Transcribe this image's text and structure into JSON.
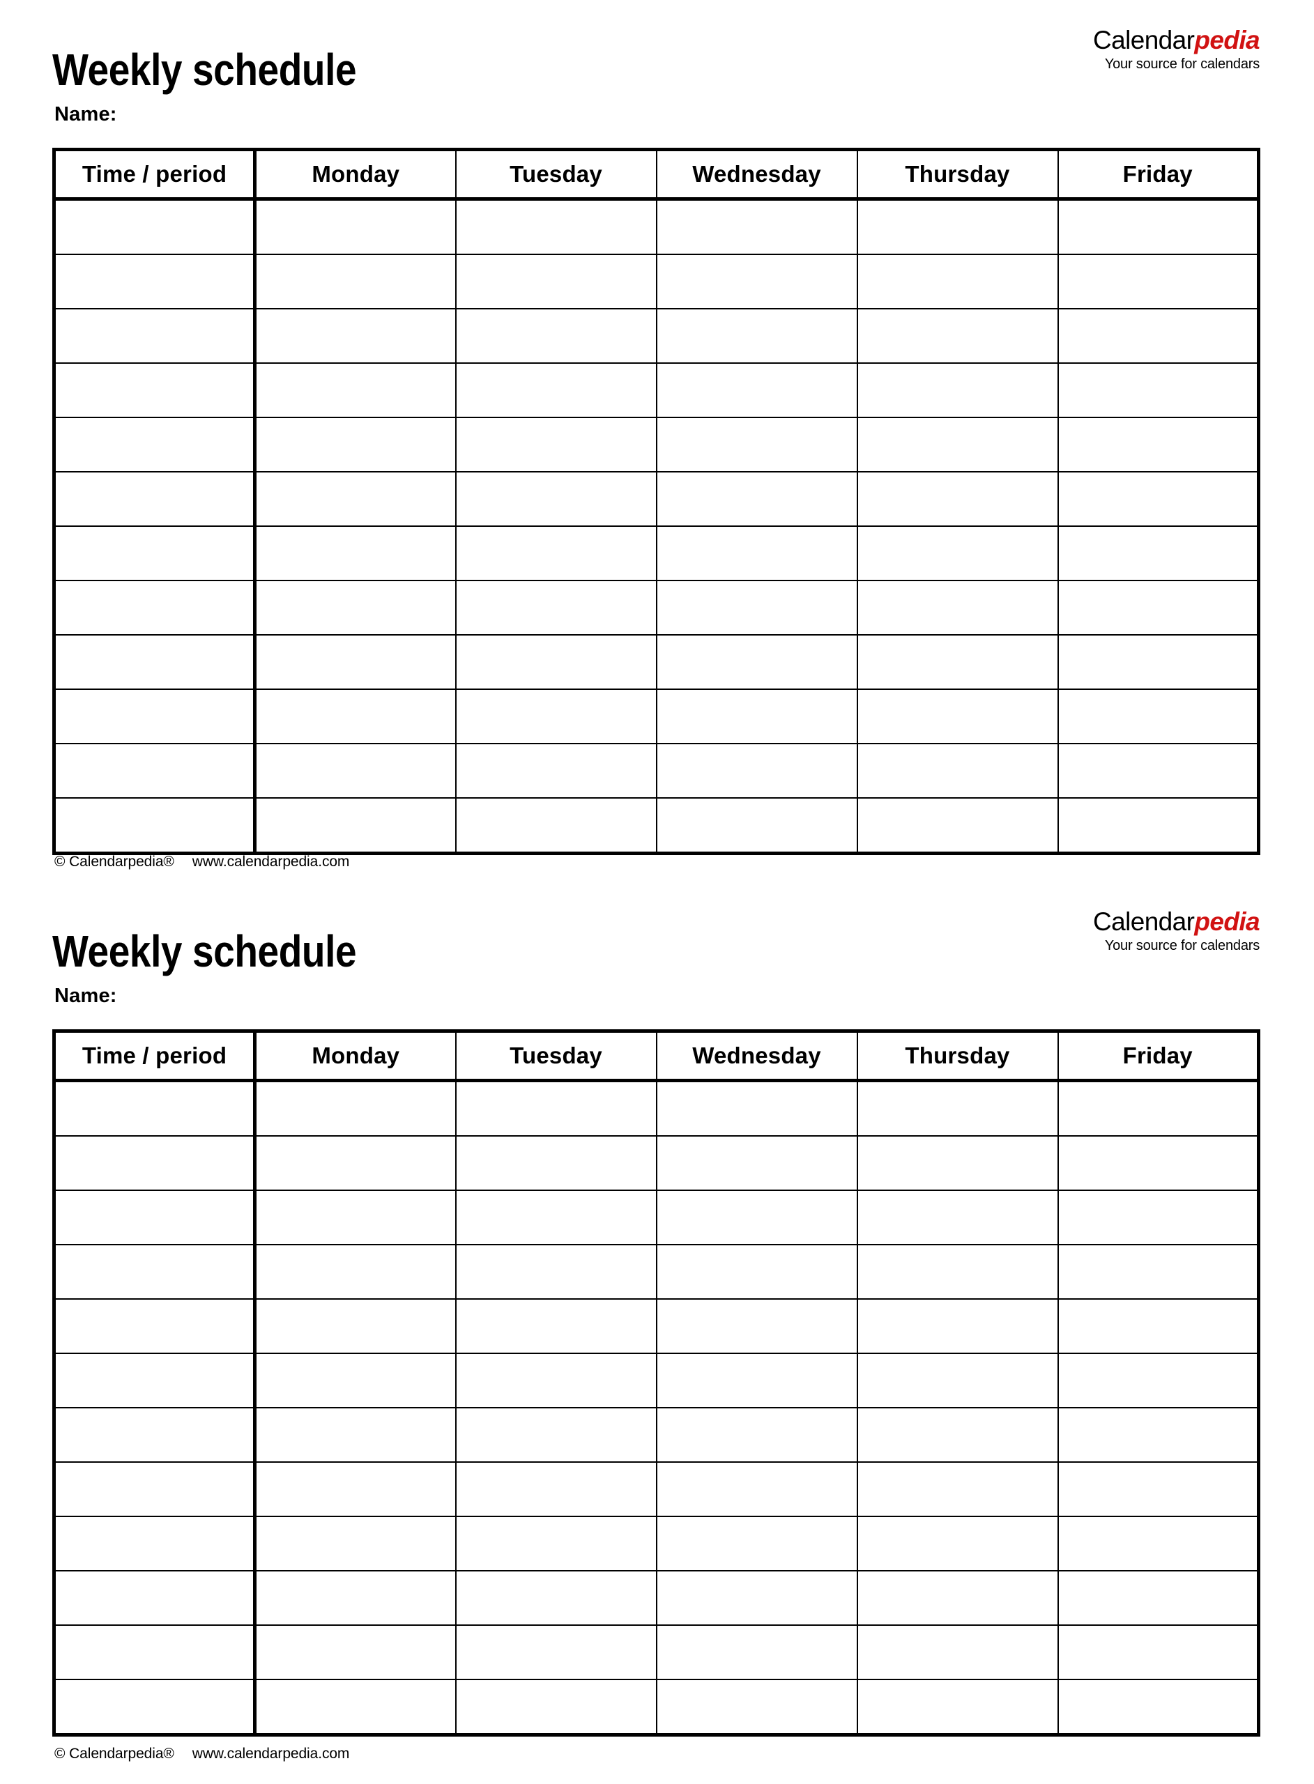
{
  "document": {
    "title": "Weekly schedule",
    "name_label": "Name:"
  },
  "brand": {
    "name_part1": "Calendar",
    "name_part2": "pedia",
    "tagline": "Your source for calendars",
    "accent_color": "#d11212"
  },
  "table": {
    "headers": [
      "Time / period",
      "Monday",
      "Tuesday",
      "Wednesday",
      "Thursday",
      "Friday"
    ],
    "body_row_count": 12,
    "cell_values": [
      [
        "",
        "",
        "",
        "",
        "",
        ""
      ],
      [
        "",
        "",
        "",
        "",
        "",
        ""
      ],
      [
        "",
        "",
        "",
        "",
        "",
        ""
      ],
      [
        "",
        "",
        "",
        "",
        "",
        ""
      ],
      [
        "",
        "",
        "",
        "",
        "",
        ""
      ],
      [
        "",
        "",
        "",
        "",
        "",
        ""
      ],
      [
        "",
        "",
        "",
        "",
        "",
        ""
      ],
      [
        "",
        "",
        "",
        "",
        "",
        ""
      ],
      [
        "",
        "",
        "",
        "",
        "",
        ""
      ],
      [
        "",
        "",
        "",
        "",
        "",
        ""
      ],
      [
        "",
        "",
        "",
        "",
        "",
        ""
      ],
      [
        "",
        "",
        "",
        "",
        "",
        ""
      ]
    ]
  },
  "footer": {
    "copyright": "© Calendarpedia®",
    "website": "www.calendarpedia.com"
  },
  "schedules": [
    {
      "title": "Weekly schedule",
      "name_label": "Name:"
    },
    {
      "title": "Weekly schedule",
      "name_label": "Name:"
    }
  ]
}
